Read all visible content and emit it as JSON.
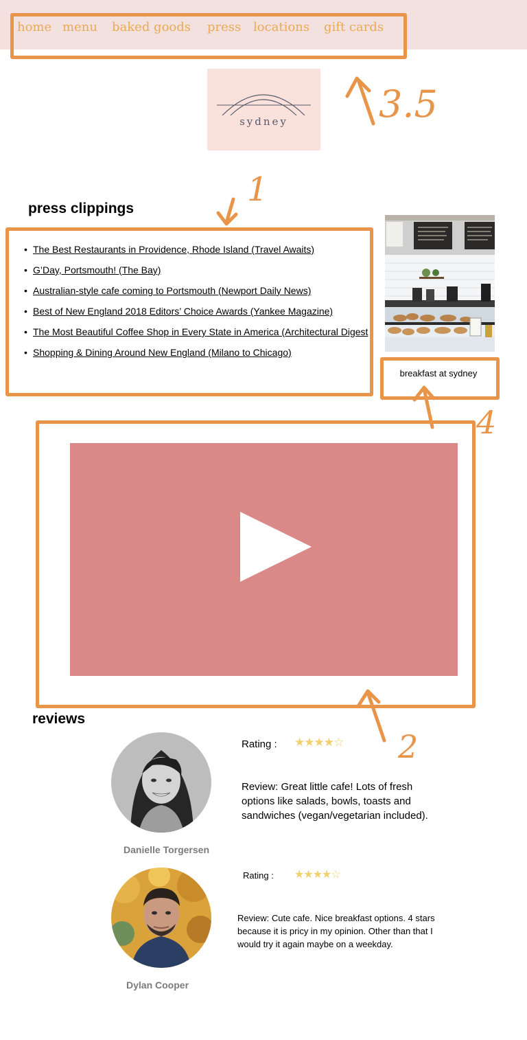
{
  "nav": {
    "items": [
      {
        "label": "home"
      },
      {
        "label": "menu"
      },
      {
        "label": "baked goods"
      },
      {
        "label": "press"
      },
      {
        "label": "locations"
      },
      {
        "label": "gift cards"
      }
    ]
  },
  "logo": {
    "text": "sydney"
  },
  "press": {
    "heading": "press clippings",
    "bullet": "•",
    "items": [
      {
        "text": "The Best Restaurants in Providence, Rhode Island (Travel Awaits)"
      },
      {
        "text": "G’Day, Portsmouth! (The Bay)"
      },
      {
        "text": "Australian-style cafe coming to Portsmouth (Newport Daily News)"
      },
      {
        "text": "Best of New England 2018 Editors’ Choice Awards (Yankee Magazine)"
      },
      {
        "text": "The Most Beautiful Coffee Shop in Every State in America (Architectural Digest"
      },
      {
        "text": "Shopping & Dining Around New England (Milano to Chicago)"
      }
    ]
  },
  "photo": {
    "caption": "breakfast at sydney"
  },
  "video": {
    "icon": "play-icon"
  },
  "reviews": {
    "heading": "reviews",
    "items": [
      {
        "name": "Danielle Torgersen",
        "rating_label": "Rating :",
        "rating_stars": "★★★★☆",
        "rating_value": 4,
        "review": "Review: Great little cafe! Lots of fresh options like salads, bowls, toasts and sandwiches (vegan/vegetarian included)."
      },
      {
        "name": "Dylan Cooper",
        "rating_label": "Rating :",
        "rating_stars": "★★★★☆",
        "rating_value": 4,
        "review": "Review: Cute cafe. Nice breakfast options. 4 stars because it is pricy in my opinion. Other than that I would try it again maybe on a weekday."
      }
    ]
  },
  "annotations": {
    "nav_number": "3.5",
    "press_number": "1",
    "video_number": "2",
    "caption_number": "4"
  },
  "colors": {
    "nav_bg": "#f2e1df",
    "nav_text": "#eaaa55",
    "logo_bg": "#fbe1dc",
    "video_bg": "#db8888",
    "star": "#f1d06f",
    "annotation": "#e8954a"
  }
}
